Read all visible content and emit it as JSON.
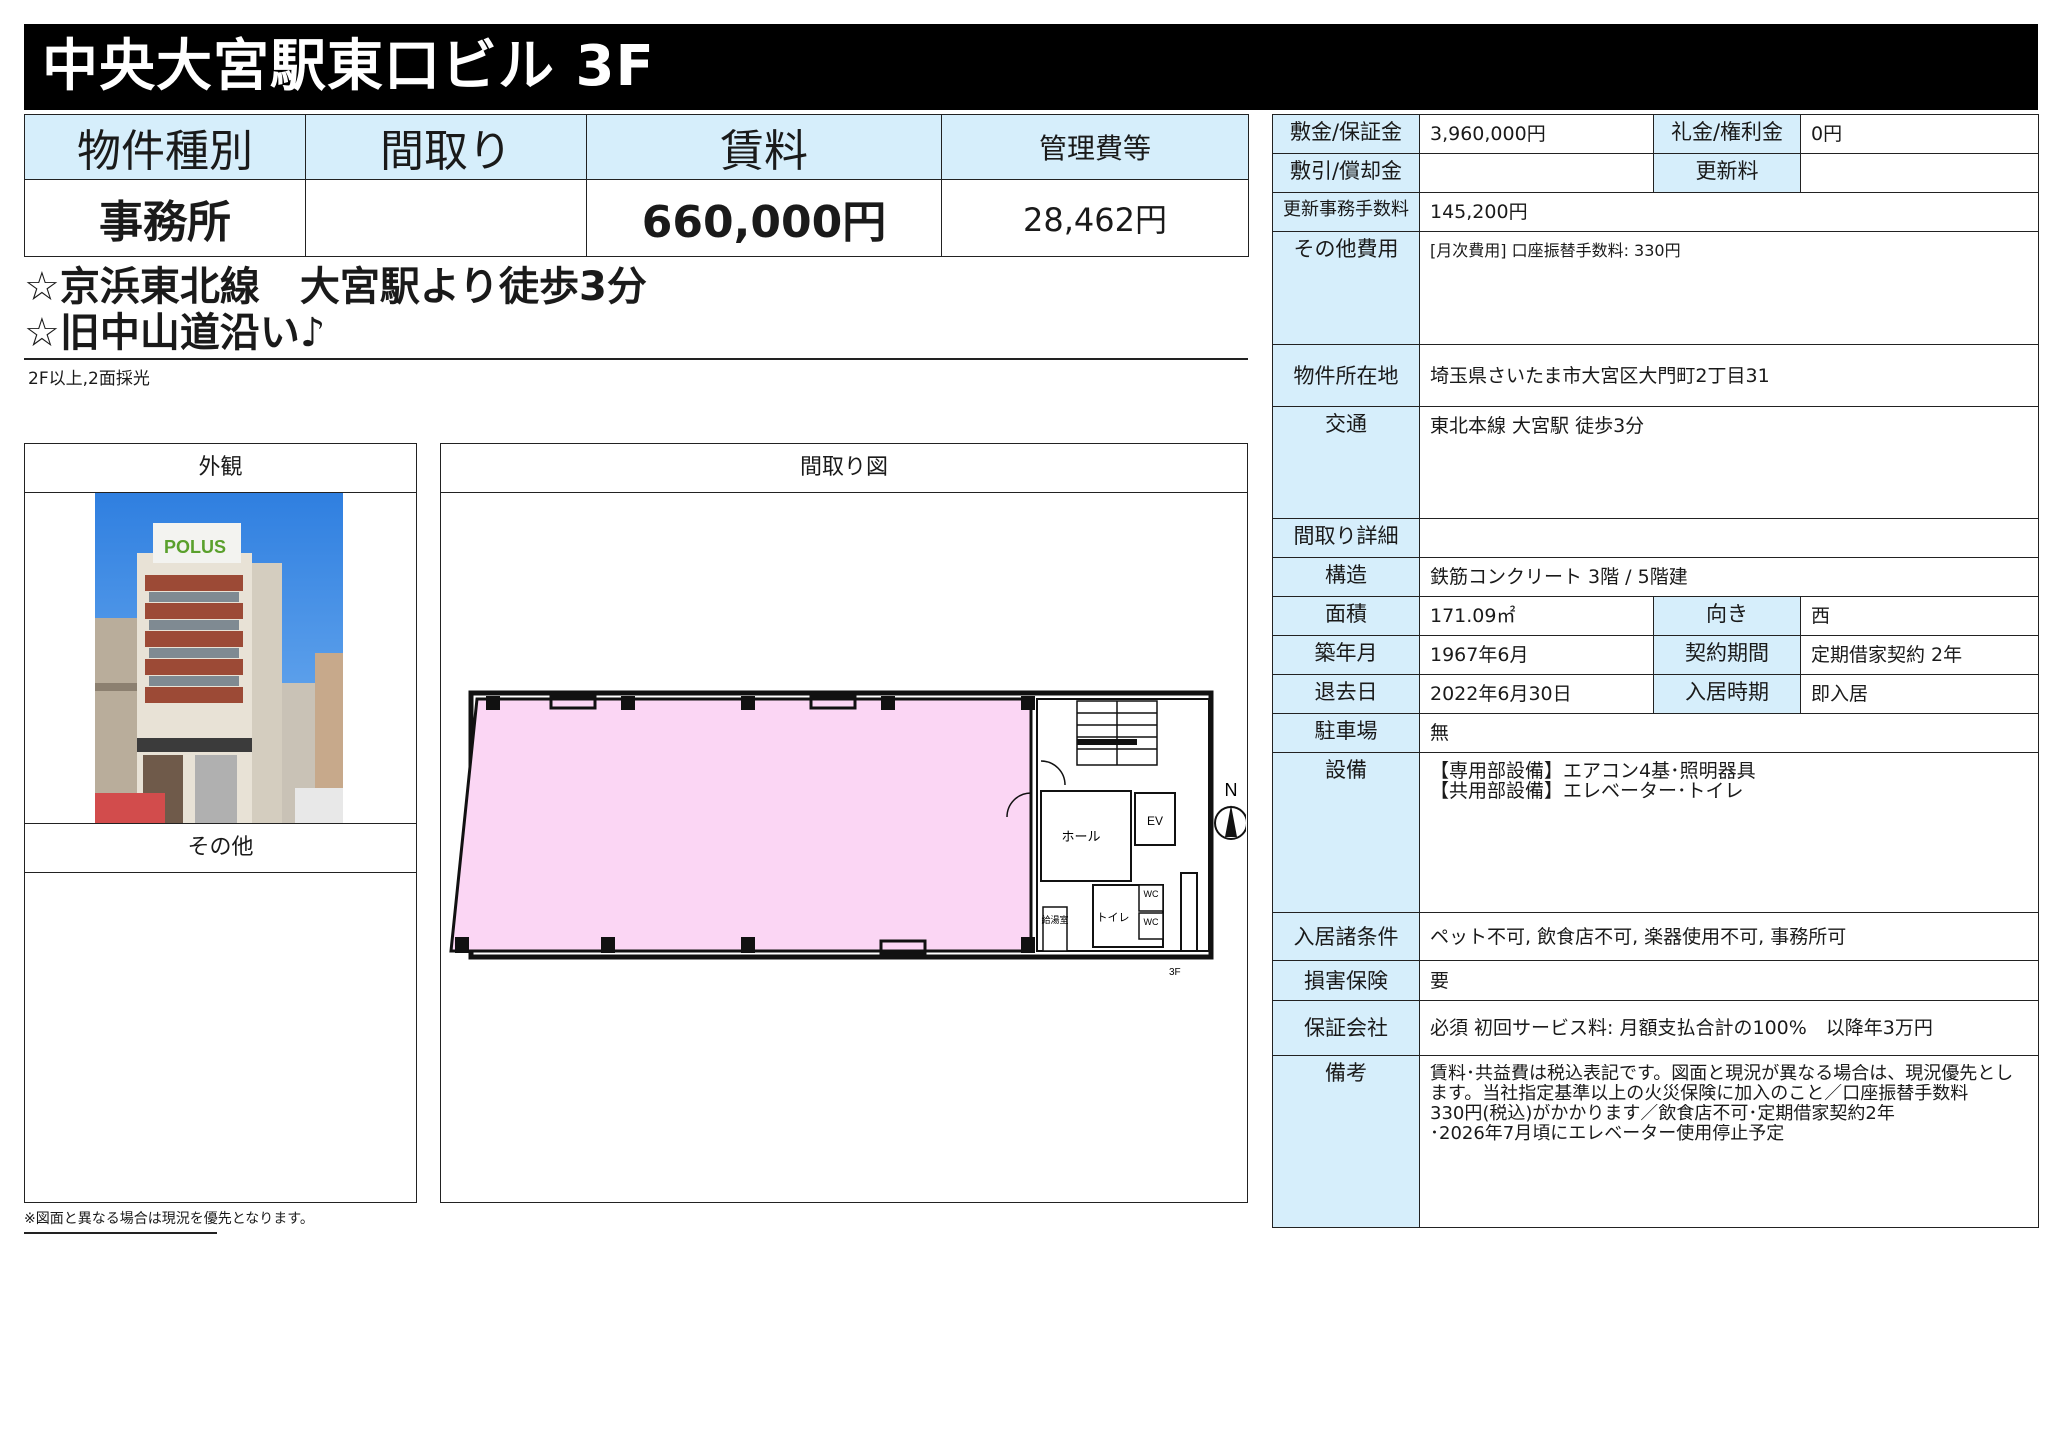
{
  "title": "中央大宮駅東口ビル 3F",
  "summary": {
    "headers": [
      "物件種別",
      "間取り",
      "賃料",
      "管理費等"
    ],
    "values": [
      "事務所",
      "",
      "660,000円",
      "28,462円"
    ]
  },
  "catch": {
    "line1": "☆京浜東北線　大宮駅より徒歩3分",
    "line2": "☆旧中山道沿い♪",
    "note": "2F以上,2面採光"
  },
  "panels": {
    "exterior": "外観",
    "other": "その他",
    "floorplan": "間取り図",
    "photo_sign": "POLUS"
  },
  "floorplan": {
    "hall": "ホール",
    "ev": "EV",
    "wc1": "WC",
    "wc2": "WC",
    "toilet": "トイレ",
    "kitchen": "給湯室",
    "north": "N",
    "floor": "3F"
  },
  "footnote": "※図面と異なる場合は現況を優先となります。",
  "details": {
    "deposit_label": "敷金/保証金",
    "deposit": "3,960,000円",
    "key_money_label": "礼金/権利金",
    "key_money": "0円",
    "amortization_label": "敷引/償却金",
    "amortization": "",
    "renewal_fee_label": "更新料",
    "renewal_fee": "",
    "renewal_admin_label": "更新事務手数料",
    "renewal_admin": "145,200円",
    "other_costs_label": "その他費用",
    "other_costs": "[月次費用] 口座振替手数料: 330円",
    "address_label": "物件所在地",
    "address": "埼玉県さいたま市大宮区大門町2丁目31",
    "transport_label": "交通",
    "transport": "東北本線 大宮駅 徒歩3分",
    "layout_detail_label": "間取り詳細",
    "layout_detail": "",
    "structure_label": "構造",
    "structure": "鉄筋コンクリート 3階 / 5階建",
    "area_label": "面積",
    "area": "171.09㎡",
    "direction_label": "向き",
    "direction": "西",
    "built_label": "築年月",
    "built": "1967年6月",
    "contract_label": "契約期間",
    "contract": "定期借家契約 2年",
    "vacate_label": "退去日",
    "vacate": "2022年6月30日",
    "move_in_label": "入居時期",
    "move_in": "即入居",
    "parking_label": "駐車場",
    "parking": "無",
    "equipment_label": "設備",
    "equipment_1": "【専用部設備】エアコン4基･照明器具",
    "equipment_2": "【共用部設備】エレベーター･トイレ",
    "conditions_label": "入居諸条件",
    "conditions": "ペット不可, 飲食店不可, 楽器使用不可, 事務所可",
    "insurance_label": "損害保険",
    "insurance": "要",
    "guarantor_label": "保証会社",
    "guarantor": "必須 初回サービス料: 月額支払合計の100%　以降年3万円",
    "remarks_label": "備考",
    "remarks_1": "賃料･共益費は税込表記です。図面と現況が異なる場合は、現況優先とし",
    "remarks_2": "ます。当社指定基準以上の火災保険に加入のこと／口座振替手数料",
    "remarks_3": "330円(税込)がかかります／飲食店不可･定期借家契約2年",
    "remarks_4": "･2026年7月頃にエレベーター使用停止予定"
  },
  "colors": {
    "header_bg": "#d6eefb",
    "floor_fill": "#fbd6f4",
    "title_bg": "#000000"
  }
}
